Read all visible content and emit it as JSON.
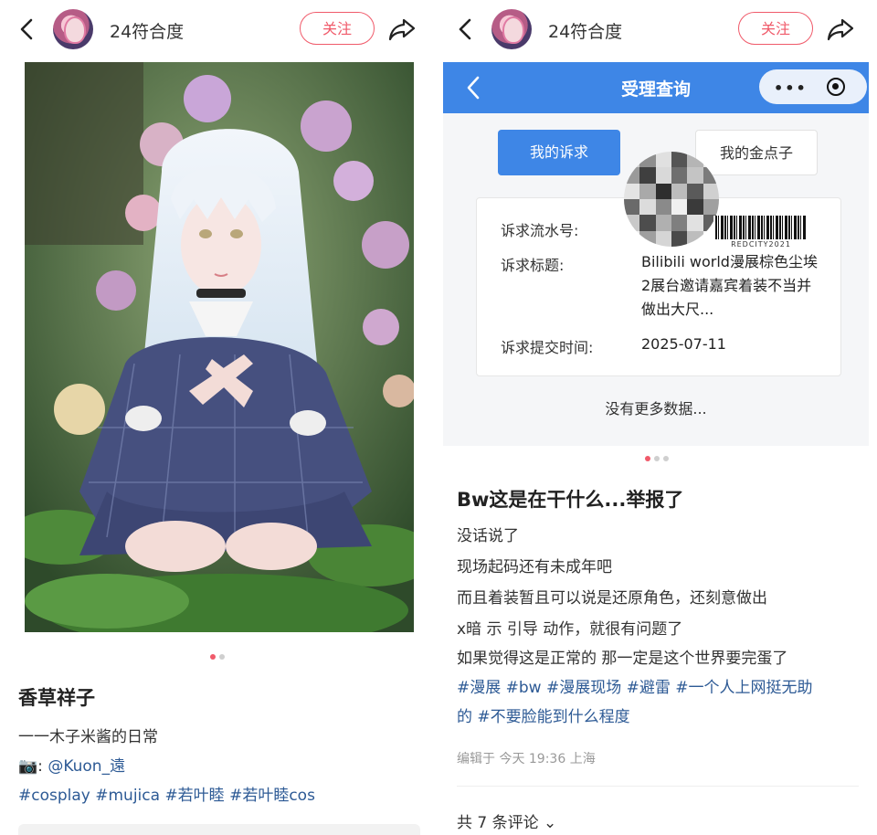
{
  "left": {
    "header": {
      "username": "24符合度",
      "follow_label": "关注"
    },
    "post": {
      "title": "香草祥子",
      "lines": [
        "一一木子米酱的日常"
      ],
      "camera_glyph": "📷",
      "credit_sep": ":",
      "credit": "@Kuon_遠",
      "hashtags": "#cosplay #mujica #若叶睦 #若叶睦cos"
    }
  },
  "right": {
    "header": {
      "username": "24符合度",
      "follow_label": "关注"
    },
    "screenshot": {
      "title": "受理查询",
      "capsule_dots": "•••",
      "tab_active": "我的诉求",
      "tab_other": "我的金点子",
      "fields": {
        "serial_label": "诉求流水号:",
        "subject_label": "诉求标题:",
        "subject_value": "Bilibili world漫展棕色尘埃2展台邀请嘉宾着装不当并做出大尺...",
        "time_label": "诉求提交时间:",
        "time_value": "2025-07-11"
      },
      "watermark": "REDCITY2021",
      "no_more": "没有更多数据..."
    },
    "post": {
      "title": "Bw这是在干什么...举报了",
      "lines": [
        "没话说了",
        "现场起码还有未成年吧",
        "而且着装暂且可以说是还原角色，还刻意做出",
        "x暗 示 引导 动作，就很有问题了",
        "如果觉得这是正常的 那一定是这个世界要完蛋了"
      ],
      "hashtags_line1": "#漫展 #bw #漫展现场 #避雷 #一个人上网挺无助",
      "hashtags_line2": "的 #不要脸能到什么程度",
      "meta": "编辑于 今天 19:36 上海",
      "comments": "共 7 条评论",
      "comments_chevron": "⌄"
    }
  },
  "colors": {
    "accent": "#f05a6a",
    "hashtag": "#2d5a95",
    "blue": "#3e86e6"
  },
  "icons": [
    "back-icon",
    "share-icon",
    "camera-icon",
    "more-icon",
    "target-icon"
  ]
}
